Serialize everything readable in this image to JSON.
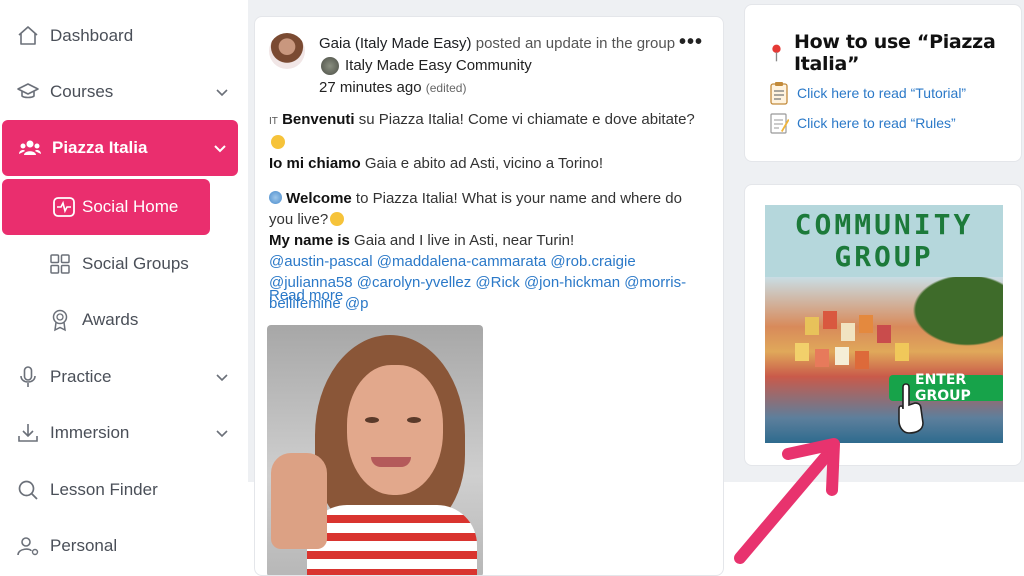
{
  "sidebar": {
    "items": [
      {
        "label": "Dashboard",
        "icon": "home-icon"
      },
      {
        "label": "Courses",
        "icon": "graduation-cap-icon"
      },
      {
        "label": "Piazza Italia",
        "icon": "users-icon"
      },
      {
        "label": "Social Home",
        "icon": "activity-icon"
      },
      {
        "label": "Social Groups",
        "icon": "grid-icon"
      },
      {
        "label": "Awards",
        "icon": "award-icon"
      },
      {
        "label": "Practice",
        "icon": "microphone-icon"
      },
      {
        "label": "Immersion",
        "icon": "download-icon"
      },
      {
        "label": "Lesson Finder",
        "icon": "search-icon"
      },
      {
        "label": "Personal",
        "icon": "user-settings-icon"
      }
    ]
  },
  "post": {
    "author": "Gaia (Italy Made Easy)",
    "action": "posted an update in the group",
    "group": "Italy Made Easy Community",
    "time": "27 minutes ago",
    "edited": "(edited)",
    "more": "•••",
    "it_flag": "IT",
    "it_bold": "Benvenuti",
    "it_text": " su Piazza Italia! Come vi chiamate e dove abitate?",
    "it_bold2": "Io mi chiamo",
    "it_text2": " Gaia e abito ad Asti, vicino a Torino!",
    "en_bold": "Welcome",
    "en_text": " to Piazza Italia! What is your name and where do you live?",
    "en_bold2": "My name is",
    "en_text2": " Gaia and I live in Asti, near Turin!",
    "mentions": "@austin-pascal @maddalena-cammarata @rob.craigie @julianna58 @carolyn-yvellez @Rick @jon-hickman @morris-bellifemine @p",
    "read_more": "Read more"
  },
  "howto": {
    "title": "How to use “Piazza Italia”",
    "link1": "Click here to read “Tutorial”",
    "link2": "Click here to read “Rules”"
  },
  "banner": {
    "line1": "COMMUNITY",
    "line2": "GROUP",
    "button": "ENTER GROUP"
  },
  "colors": {
    "accent": "#ea2e6e",
    "link": "#2b79c8",
    "banner_green": "#17a34a",
    "arrow": "#e8336e"
  }
}
